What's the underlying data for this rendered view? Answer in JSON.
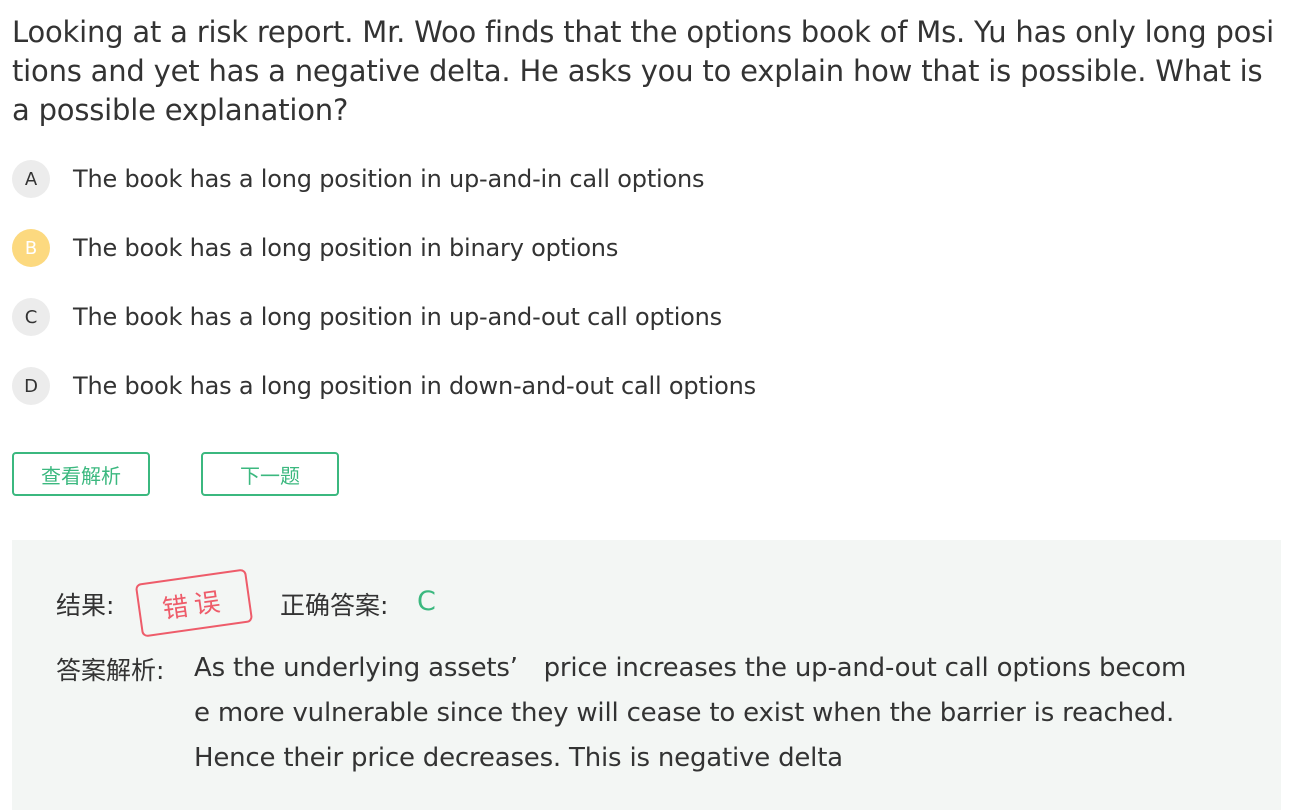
{
  "question": {
    "text": "Looking at a risk report. Mr. Woo finds that the options book of Ms. Yu has only long positions and yet has a negative delta. He asks you to explain how that is possible. What is a possible explanation?"
  },
  "options": [
    {
      "letter": "A",
      "text": "The book has a long position in up-and-in call options"
    },
    {
      "letter": "B",
      "text": "The book has a long position in binary options"
    },
    {
      "letter": "C",
      "text": "The book has a long position in up-and-out call options"
    },
    {
      "letter": "D",
      "text": "The book has a long position in down-and-out call options"
    }
  ],
  "selected_option": "B",
  "buttons": {
    "view_analysis": "查看解析",
    "next_question": "下一题"
  },
  "result": {
    "label": "结果:",
    "stamp": "错误",
    "correct_label": "正确答案:",
    "correct_value": "C",
    "explanation_label": "答案解析:",
    "explanation": "As the underlying assets’　price increases the up-and-out call options become more vulnerable since they will cease to exist when the barrier is reached. Hence their price decreases. This is negative delta"
  },
  "colors": {
    "accent_green": "#3bb87f",
    "selected_yellow": "#fcd97f",
    "stamp_red": "#ee5c6a",
    "panel_bg": "#f3f6f4"
  }
}
